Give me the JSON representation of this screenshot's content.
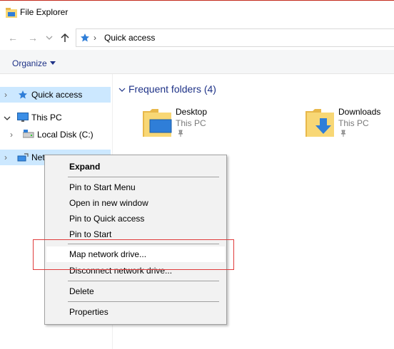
{
  "window": {
    "title": "File Explorer"
  },
  "toolbar": {
    "back_icon": "back-arrow-icon",
    "forward_icon": "forward-arrow-icon",
    "recent_icon": "chevron-down-icon",
    "up_icon": "up-arrow-icon"
  },
  "address": {
    "crumb": "Quick access",
    "separator": "›"
  },
  "ribbon": {
    "organize_label": "Organize"
  },
  "navpane": {
    "items": [
      {
        "label": "Quick access",
        "icon": "star-icon",
        "selected": true
      },
      {
        "label": "This PC",
        "icon": "monitor-icon",
        "expanded": true
      },
      {
        "label": "Local Disk (C:)",
        "icon": "drive-icon"
      },
      {
        "label": "Network",
        "icon": "network-icon",
        "visible_text": "Netw"
      }
    ]
  },
  "content": {
    "group_title": "Frequent folders (4)",
    "folders": [
      {
        "name": "Desktop",
        "location": "This PC",
        "icon": "desktop-folder-icon"
      },
      {
        "name": "Downloads",
        "location": "This PC",
        "icon": "downloads-folder-icon"
      }
    ]
  },
  "context_menu": {
    "items": [
      {
        "label": "Expand",
        "bold": true
      },
      {
        "label": "Pin to Start Menu"
      },
      {
        "label": "Open in new window"
      },
      {
        "label": "Pin to Quick access"
      },
      {
        "label": "Pin to Start"
      },
      {
        "label": "Map network drive...",
        "hovered": true
      },
      {
        "label": "Disconnect network drive..."
      },
      {
        "label": "Delete"
      },
      {
        "label": "Properties"
      }
    ]
  },
  "colors": {
    "accent": "#1e3287",
    "selection": "#cce8ff",
    "menu_bg": "#f2f2f2",
    "annotation_box": "#e03c3c",
    "folder_yellow": "#f8d775"
  }
}
